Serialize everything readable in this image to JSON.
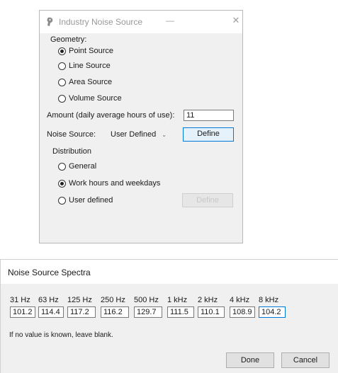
{
  "industry_dialog": {
    "title": "Industry Noise Source",
    "minimize_glyph": "—",
    "close_glyph": "✕",
    "geometry": {
      "label": "Geometry:",
      "options": [
        {
          "label": "Point Source",
          "checked": true
        },
        {
          "label": "Line Source",
          "checked": false
        },
        {
          "label": "Area Source",
          "checked": false
        },
        {
          "label": "Volume Source",
          "checked": false
        }
      ]
    },
    "amount": {
      "label": "Amount (daily average hours of use):",
      "value": "11"
    },
    "noise_source": {
      "label": "Noise Source:",
      "selected": "User Defined",
      "define_label": "Define"
    },
    "distribution": {
      "label": "Distribution",
      "options": [
        {
          "label": "General",
          "checked": false
        },
        {
          "label": "Work hours and weekdays",
          "checked": true
        },
        {
          "label": "User defined",
          "checked": false
        }
      ],
      "disabled_button_label": "Define"
    }
  },
  "spectra_dialog": {
    "title": "Noise Source Spectra",
    "bands": [
      {
        "label": "31 Hz",
        "value": "101.2"
      },
      {
        "label": "63 Hz",
        "value": "114.4"
      },
      {
        "label": "125 Hz",
        "value": "117.2"
      },
      {
        "label": "250 Hz",
        "value": "116.2"
      },
      {
        "label": "500 Hz",
        "value": "129.7"
      },
      {
        "label": "1 kHz",
        "value": "111.5"
      },
      {
        "label": "2 kHz",
        "value": "110.1"
      },
      {
        "label": "4 kHz",
        "value": "108.9"
      },
      {
        "label": "8 kHz",
        "value": "104.2"
      }
    ],
    "hint": "If no value is known, leave blank.",
    "done_label": "Done",
    "cancel_label": "Cancel"
  },
  "colors": {
    "accent": "#0078d7",
    "dialog_bg": "#f0f0f0"
  }
}
